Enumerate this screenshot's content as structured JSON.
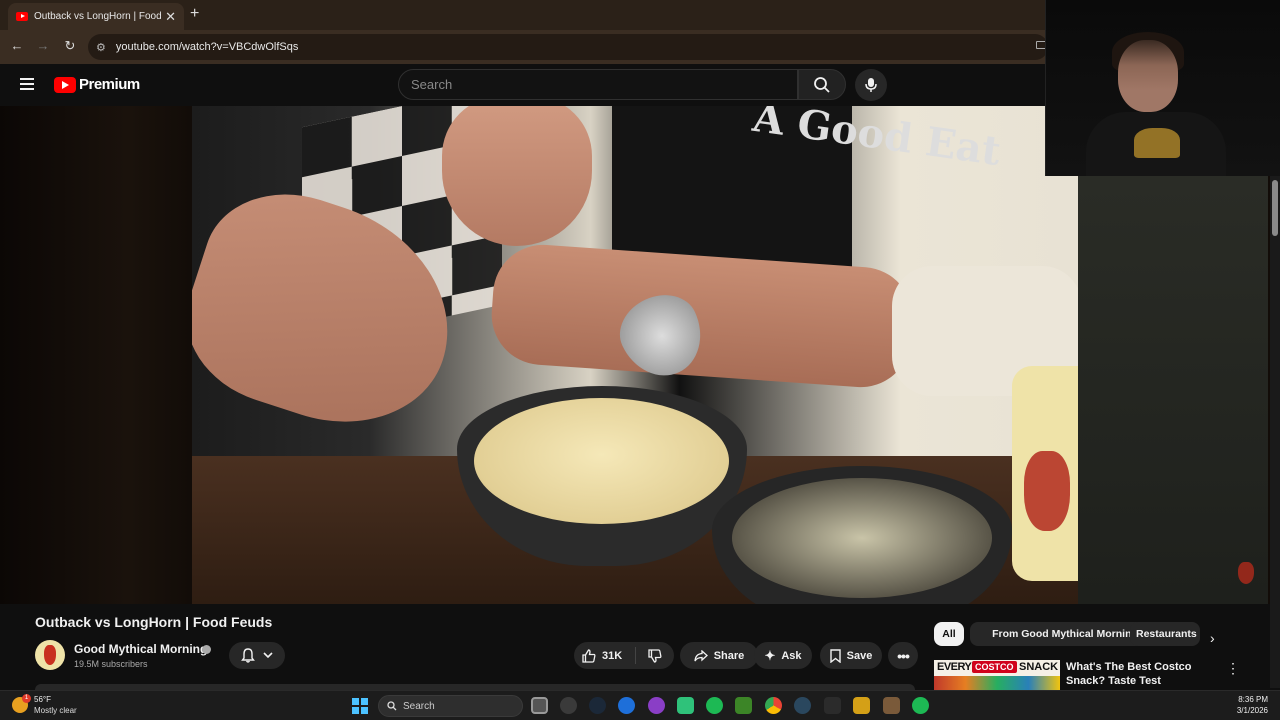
{
  "browser": {
    "tab_title": "Outback vs LongHorn | Food Fe",
    "url": "youtube.com/watch?v=VBCdwOlfSqs"
  },
  "youtube": {
    "logo_text": "Premium",
    "search_placeholder": "Search"
  },
  "video": {
    "shirt_text": "A Good Eat"
  },
  "watch": {
    "title": "Outback vs LongHorn | Food Feuds",
    "channel_name": "Good Mythical Morning",
    "subscribers": "19.5M subscribers",
    "like_count": "31K",
    "share_label": "Share",
    "ask_label": "Ask",
    "save_label": "Save"
  },
  "sidebar": {
    "chips": [
      "All",
      "From Good Mythical Morning",
      "Restaurants"
    ],
    "recommendation": {
      "title": "What's The Best Costco Snack? Taste Test",
      "thumb_word1": "EVERY",
      "thumb_word2": "COSTCO",
      "thumb_word3": "SNACK"
    }
  },
  "taskbar": {
    "weather_temp": "56°F",
    "weather_desc": "Mostly clear",
    "weather_badge": "1",
    "search_placeholder": "Search",
    "time": "8:36 PM",
    "date": "3/1/2026"
  },
  "colors": {
    "youtube_red": "#ff0000",
    "background": "#0f0f0f",
    "pill": "#272727"
  }
}
